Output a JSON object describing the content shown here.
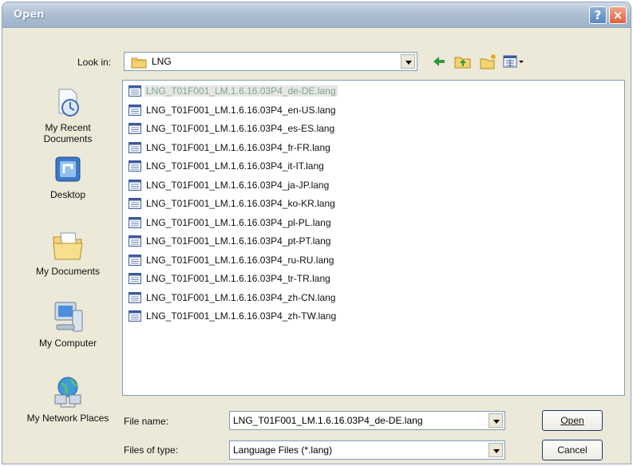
{
  "window": {
    "title": "Open",
    "help_glyph": "?",
    "close_glyph": "×"
  },
  "look_in": {
    "label": "Look in:",
    "value": "LNG"
  },
  "toolbar": {
    "icons": [
      "back-arrow-icon",
      "up-folder-icon",
      "new-folder-icon",
      "view-menu-icon"
    ]
  },
  "places": [
    {
      "label": "My Recent Documents",
      "icon": "recent-documents-icon"
    },
    {
      "label": "Desktop",
      "icon": "desktop-icon"
    },
    {
      "label": "My Documents",
      "icon": "my-documents-icon"
    },
    {
      "label": "My Computer",
      "icon": "my-computer-icon"
    },
    {
      "label": "My Network Places",
      "icon": "network-places-icon"
    }
  ],
  "files": [
    "LNG_T01F001_LM.1.6.16.03P4_de-DE.lang",
    "LNG_T01F001_LM.1.6.16.03P4_en-US.lang",
    "LNG_T01F001_LM.1.6.16.03P4_es-ES.lang",
    "LNG_T01F001_LM.1.6.16.03P4_fr-FR.lang",
    "LNG_T01F001_LM.1.6.16.03P4_it-IT.lang",
    "LNG_T01F001_LM.1.6.16.03P4_ja-JP.lang",
    "LNG_T01F001_LM.1.6.16.03P4_ko-KR.lang",
    "LNG_T01F001_LM.1.6.16.03P4_pl-PL.lang",
    "LNG_T01F001_LM.1.6.16.03P4_pt-PT.lang",
    "LNG_T01F001_LM.1.6.16.03P4_ru-RU.lang",
    "LNG_T01F001_LM.1.6.16.03P4_tr-TR.lang",
    "LNG_T01F001_LM.1.6.16.03P4_zh-CN.lang",
    "LNG_T01F001_LM.1.6.16.03P4_zh-TW.lang"
  ],
  "selected_file_index": 0,
  "file_name": {
    "label": "File name:",
    "value": "LNG_T01F001_LM.1.6.16.03P4_de-DE.lang"
  },
  "file_type": {
    "label": "Files of type:",
    "value": "Language Files (*.lang)"
  },
  "buttons": {
    "open": "Open",
    "cancel": "Cancel"
  },
  "colors": {
    "titlebar": "#aebfd3",
    "dialog_bg": "#ece9d8",
    "input_border": "#7f9db9",
    "close_button": "#e0603c",
    "help_button": "#5d86bf"
  }
}
